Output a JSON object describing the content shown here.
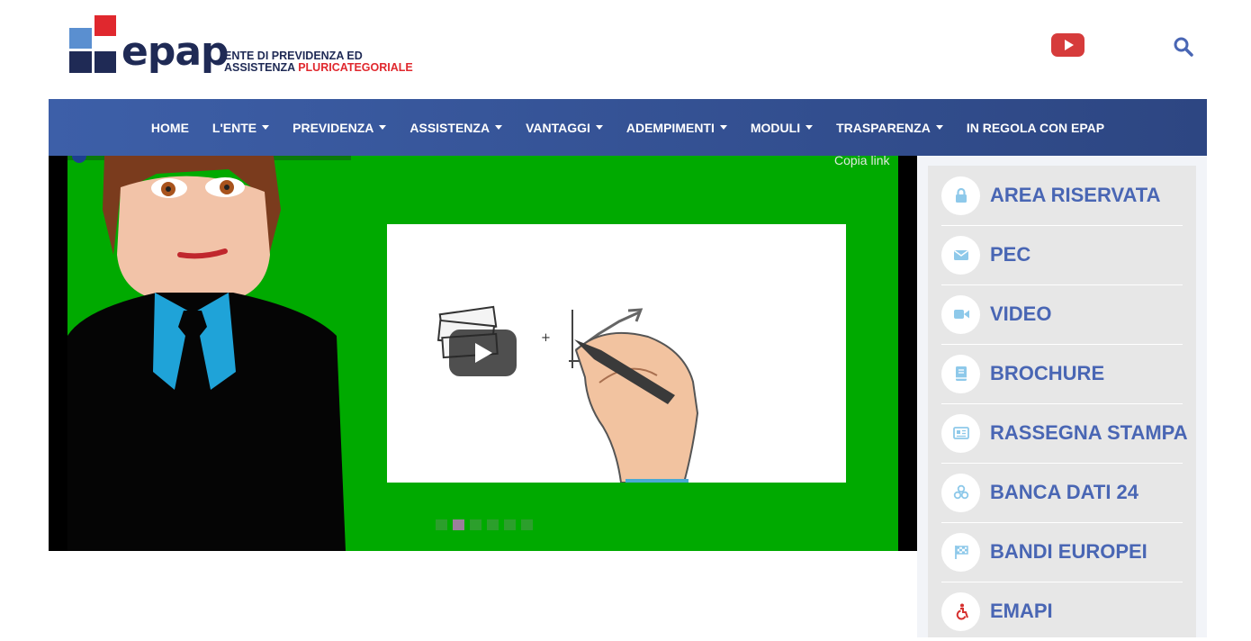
{
  "logo": {
    "wordmark": "epap",
    "tagline_line1": "ENTE DI PREVIDENZA ED",
    "tagline_line2_a": "ASSISTENZA",
    "tagline_line2_b": "PLURICATEGORIALE"
  },
  "header_icons": {
    "youtube": "youtube-icon",
    "search": "search-icon"
  },
  "nav": {
    "items": [
      {
        "label": "HOME",
        "dropdown": false
      },
      {
        "label": "L'ENTE",
        "dropdown": true
      },
      {
        "label": "PREVIDENZA",
        "dropdown": true
      },
      {
        "label": "ASSISTENZA",
        "dropdown": true
      },
      {
        "label": "VANTAGGI",
        "dropdown": true
      },
      {
        "label": "ADEMPIMENTI",
        "dropdown": true
      },
      {
        "label": "MODULI",
        "dropdown": true
      },
      {
        "label": "TRASPARENZA",
        "dropdown": true
      },
      {
        "label": "IN REGOLA CON EPAP",
        "dropdown": false
      }
    ]
  },
  "video": {
    "copy_link": "Copia link",
    "dots_count": 6,
    "active_dot": 1
  },
  "sidebar": {
    "items": [
      {
        "label": "AREA RISERVATA",
        "icon": "lock-icon"
      },
      {
        "label": "PEC",
        "icon": "envelope-icon"
      },
      {
        "label": "VIDEO",
        "icon": "video-camera-icon"
      },
      {
        "label": "BROCHURE",
        "icon": "book-icon"
      },
      {
        "label": "RASSEGNA STAMPA",
        "icon": "newspaper-icon"
      },
      {
        "label": "BANCA DATI 24",
        "icon": "database-icon"
      },
      {
        "label": "BANDI EUROPEI",
        "icon": "flag-checkered-icon"
      },
      {
        "label": "EMAPI",
        "icon": "accessibility-icon"
      }
    ]
  },
  "colors": {
    "brand_blue": "#4966b4",
    "brand_navy": "#1f2a55",
    "brand_light_blue": "#5a8fd0",
    "brand_red": "#e0282e",
    "nav_gradient_start": "#3d5fa8",
    "nav_gradient_end": "#2d4682",
    "video_green": "#00aa00",
    "icon_light_blue": "#8ec9ea",
    "youtube_red": "#d63b3b"
  }
}
